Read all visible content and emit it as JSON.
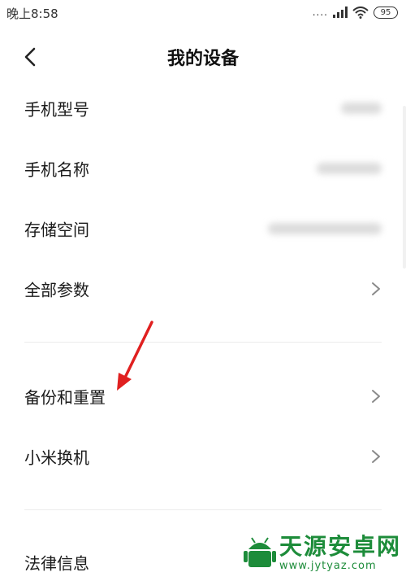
{
  "status": {
    "time": "晚上8:58",
    "signal": "....",
    "battery": "95"
  },
  "header": {
    "title": "我的设备"
  },
  "rows": [
    {
      "label": "手机型号",
      "value_hidden": true
    },
    {
      "label": "手机名称",
      "value_hidden": true
    },
    {
      "label": "存储空间",
      "value_hidden": true
    },
    {
      "label": "全部参数",
      "has_chevron": true
    },
    {
      "label": "备份和重置",
      "has_chevron": true
    },
    {
      "label": "小米换机",
      "has_chevron": true
    },
    {
      "label": "法律信息"
    }
  ],
  "watermark": {
    "title": "天源安卓网",
    "url": "www.jytyaz.com"
  },
  "colors": {
    "annotation_arrow": "#e02020",
    "watermark_green": "#1d8c3a"
  }
}
